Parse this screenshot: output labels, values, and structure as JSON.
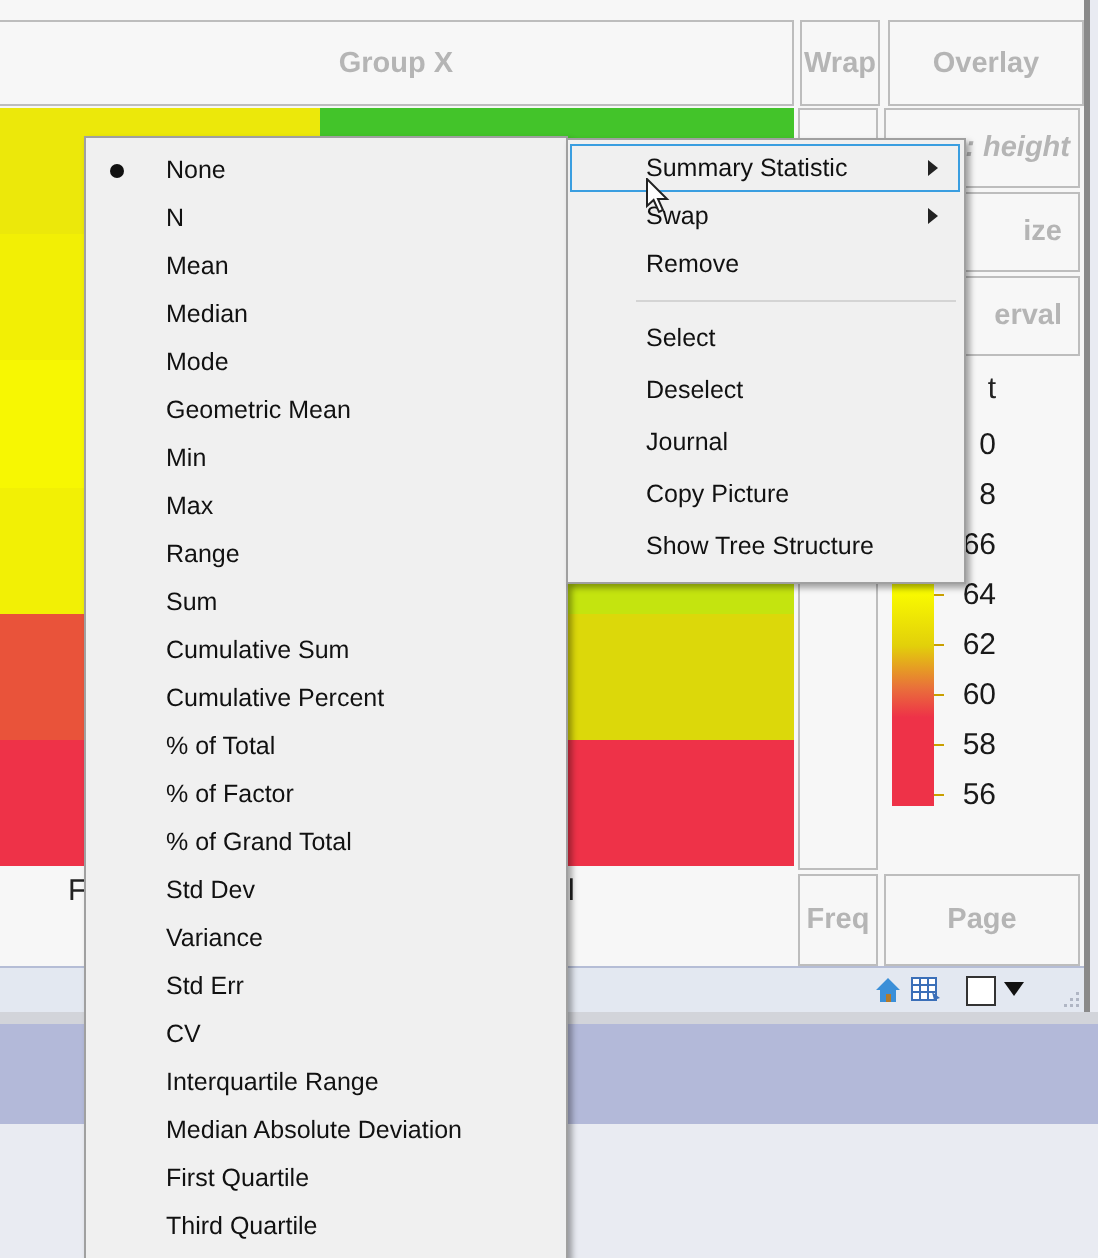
{
  "drop_zones": {
    "group_x": "Group X",
    "wrap": "Wrap",
    "overlay": "Overlay",
    "color_zone": ": height",
    "size": "ize",
    "interval": "erval",
    "freq": "Freq",
    "page": "Page"
  },
  "heatmap": {
    "columns": [
      {
        "cells": [
          {
            "color": "#ece80a"
          },
          {
            "color": "#f2ef05"
          },
          {
            "color": "#f7f702"
          },
          {
            "color": "#f2f005"
          },
          {
            "color": "#e9533a"
          },
          {
            "color": "#ee3248"
          }
        ]
      },
      {
        "cells": [
          {
            "color": "#43c42a"
          },
          null,
          null,
          {
            "color": "#c4e40f"
          },
          {
            "color": "#dcd80a"
          },
          {
            "color": "#ee3248"
          }
        ]
      }
    ],
    "axis_labels": [
      "F",
      "l"
    ]
  },
  "legend": {
    "title": "t",
    "labels": [
      "0",
      "8",
      "66",
      "64",
      "62",
      "60",
      "58",
      "56"
    ]
  },
  "context_menu": {
    "items": [
      {
        "kind": "submenu",
        "label": "Summary Statistic",
        "highlighted": true
      },
      {
        "kind": "submenu",
        "label": "Swap",
        "highlighted": false
      },
      {
        "kind": "item",
        "label": "Remove",
        "highlighted": false
      },
      {
        "kind": "separator"
      },
      {
        "kind": "item",
        "label": "Select",
        "highlighted": false
      },
      {
        "kind": "item",
        "label": "Deselect",
        "highlighted": false
      },
      {
        "kind": "item",
        "label": "Journal",
        "highlighted": false
      },
      {
        "kind": "item",
        "label": "Copy Picture",
        "highlighted": false
      },
      {
        "kind": "item",
        "label": "Show Tree Structure",
        "highlighted": false
      }
    ]
  },
  "submenu": {
    "items": [
      {
        "label": "None",
        "selected": true
      },
      {
        "label": "N",
        "selected": false
      },
      {
        "label": "Mean",
        "selected": false
      },
      {
        "label": "Median",
        "selected": false
      },
      {
        "label": "Mode",
        "selected": false
      },
      {
        "label": "Geometric Mean",
        "selected": false
      },
      {
        "label": "Min",
        "selected": false
      },
      {
        "label": "Max",
        "selected": false
      },
      {
        "label": "Range",
        "selected": false
      },
      {
        "label": "Sum",
        "selected": false
      },
      {
        "label": "Cumulative Sum",
        "selected": false
      },
      {
        "label": "Cumulative Percent",
        "selected": false
      },
      {
        "label": "% of Total",
        "selected": false
      },
      {
        "label": "% of Factor",
        "selected": false
      },
      {
        "label": "% of Grand Total",
        "selected": false
      },
      {
        "label": "Std Dev",
        "selected": false
      },
      {
        "label": "Variance",
        "selected": false
      },
      {
        "label": "Std Err",
        "selected": false
      },
      {
        "label": "CV",
        "selected": false
      },
      {
        "label": "Interquartile Range",
        "selected": false
      },
      {
        "label": "Median Absolute Deviation",
        "selected": false
      },
      {
        "label": "First Quartile",
        "selected": false
      },
      {
        "label": "Third Quartile",
        "selected": false
      }
    ]
  }
}
